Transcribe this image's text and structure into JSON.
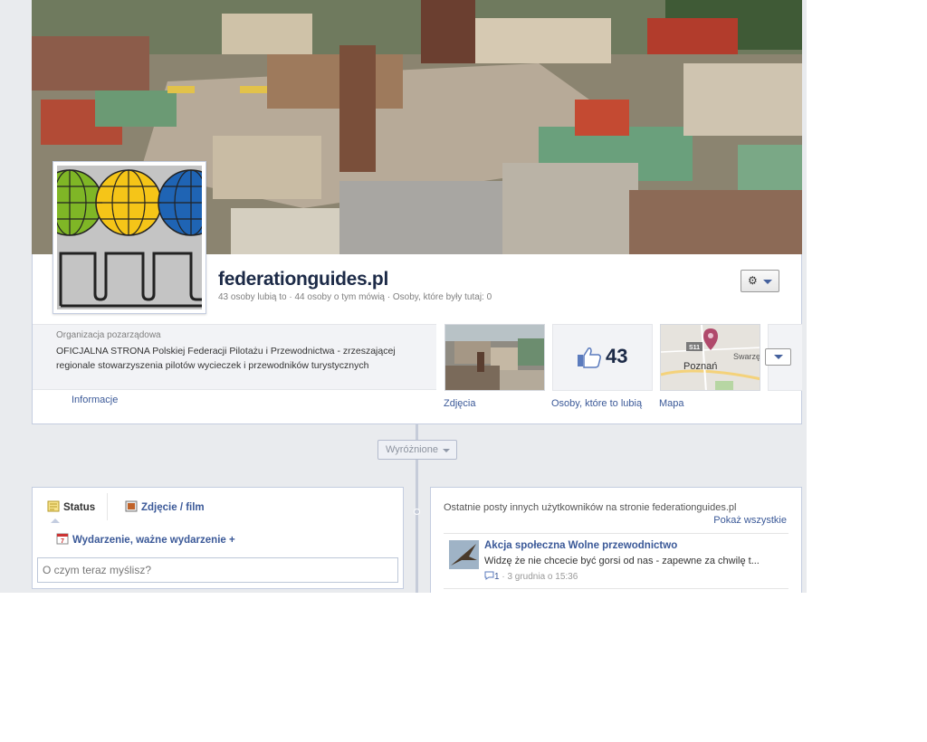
{
  "page": {
    "name": "federationguides.pl",
    "stats": "43 osoby lubią to · 44 osoby o tym mówią · Osoby, które były tutaj: 0"
  },
  "info": {
    "category": "Organizacja pozarządowa",
    "about": "OFICJALNA STRONA Polskiej Federacji Pilotażu i Przewodnictwa - zrzeszającej regionale stowarzyszenia pilotów wycieczek i przewodników turystycznych",
    "info_link": "Informacje"
  },
  "thumbs": {
    "photos_label": "Zdjęcia",
    "likes_label": "Osoby, które to lubią",
    "likes_count": "43",
    "map_label": "Mapa",
    "map_city": "Poznań",
    "map_city2": "Swarzę",
    "map_road": "S11"
  },
  "timeline": {
    "highlight_label": "Wyróżnione"
  },
  "composer": {
    "tab_status": "Status",
    "tab_photo": "Zdjęcie / film",
    "tab_event": "Wydarzenie, ważne wydarzenie +",
    "placeholder": "O czym teraz myślisz?"
  },
  "recent": {
    "title": "Ostatnie posty innych użytkowników na stronie federationguides.pl",
    "show_all": "Pokaż wszystkie",
    "post_title": "Akcja społeczna Wolne przewodnictwo",
    "post_snippet": "Widzę że nie chcecie być gorsi od nas - zapewne za chwilę t...",
    "post_comments": "1",
    "post_time": "· 3 grudnia o 15:36"
  },
  "icons": {
    "settings": "gear-icon",
    "like": "thumbs-up-icon",
    "status": "status-note-icon",
    "photo": "photo-icon",
    "event": "calendar-icon",
    "comment": "comment-icon",
    "map_pin": "map-pin-icon"
  },
  "colors": {
    "link": "#3b5998",
    "title": "#1c2a47",
    "background": "#e9ebee",
    "logo_green": "#7fb626",
    "logo_yellow": "#f5c518",
    "logo_blue": "#1f64b4"
  }
}
